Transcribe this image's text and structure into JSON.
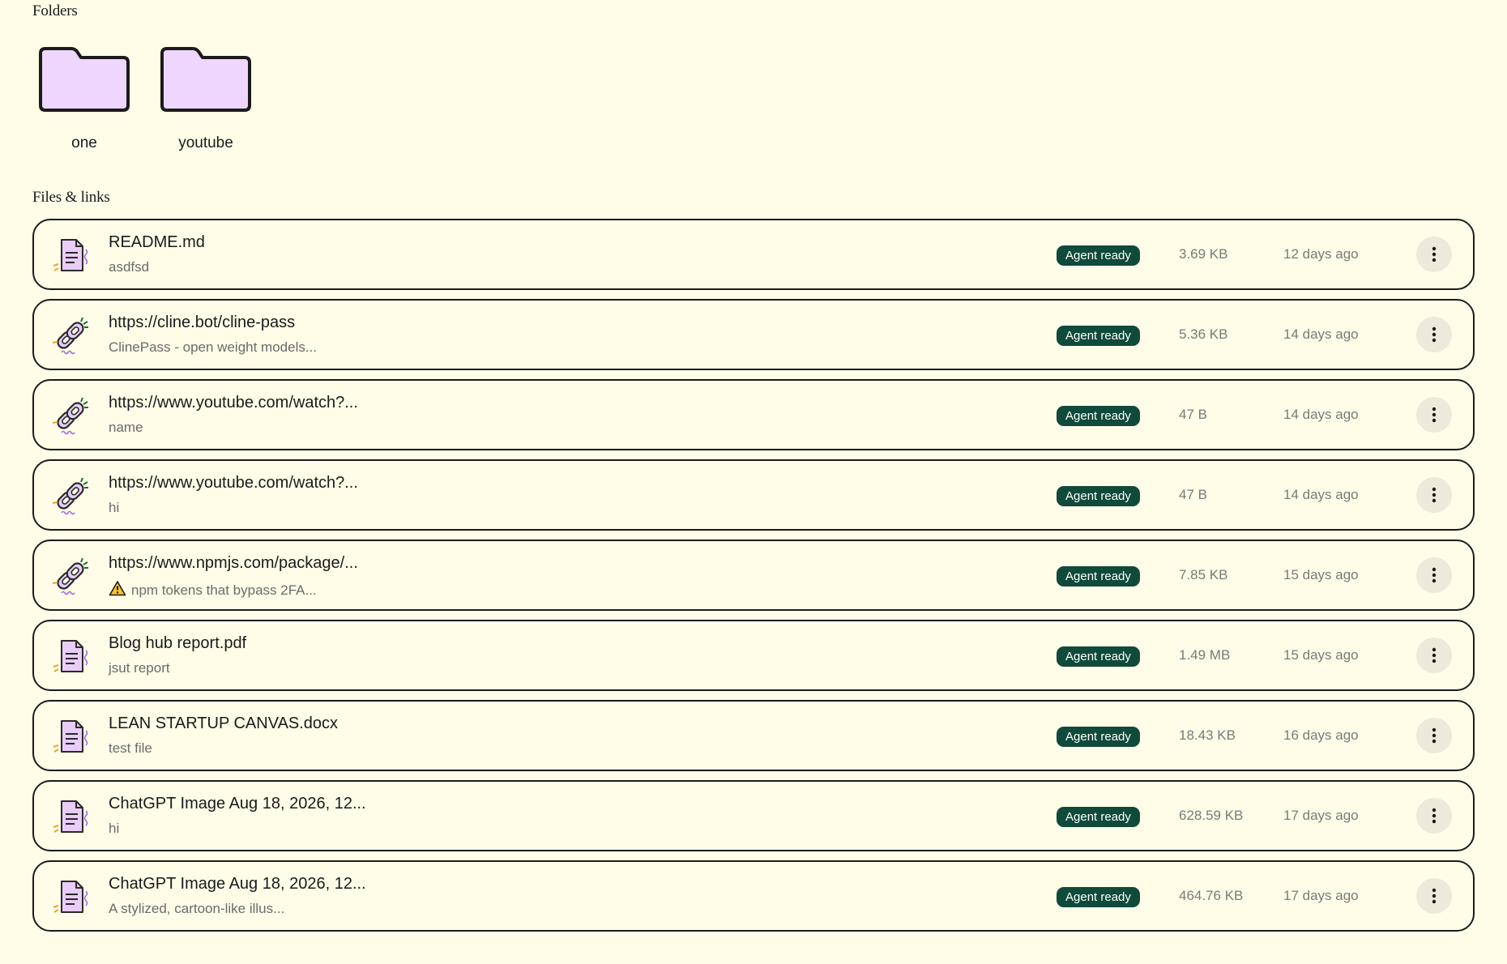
{
  "folders_section": {
    "title": "Folders",
    "items": [
      {
        "name": "one"
      },
      {
        "name": "youtube"
      }
    ]
  },
  "files_section": {
    "title": "Files & links",
    "items": [
      {
        "type": "file",
        "title": "README.md",
        "description": "asdfsd",
        "warning": false,
        "badge": "Agent ready",
        "size": "3.69 KB",
        "date": "12 days ago"
      },
      {
        "type": "link",
        "title": "https://cline.bot/cline-pass",
        "description": "ClinePass - open weight models...",
        "warning": false,
        "badge": "Agent ready",
        "size": "5.36 KB",
        "date": "14 days ago"
      },
      {
        "type": "link",
        "title": "https://www.youtube.com/watch?...",
        "description": "name",
        "warning": false,
        "badge": "Agent ready",
        "size": "47 B",
        "date": "14 days ago"
      },
      {
        "type": "link",
        "title": "https://www.youtube.com/watch?...",
        "description": "hi",
        "warning": false,
        "badge": "Agent ready",
        "size": "47 B",
        "date": "14 days ago"
      },
      {
        "type": "link",
        "title": "https://www.npmjs.com/package/...",
        "description": "npm tokens that bypass 2FA...",
        "warning": true,
        "badge": "Agent ready",
        "size": "7.85 KB",
        "date": "15 days ago"
      },
      {
        "type": "file",
        "title": "Blog hub report.pdf",
        "description": "jsut report",
        "warning": false,
        "badge": "Agent ready",
        "size": "1.49 MB",
        "date": "15 days ago"
      },
      {
        "type": "file",
        "title": "LEAN STARTUP CANVAS.docx",
        "description": "test file",
        "warning": false,
        "badge": "Agent ready",
        "size": "18.43 KB",
        "date": "16 days ago"
      },
      {
        "type": "file",
        "title": "ChatGPT Image Aug 18, 2026, 12...",
        "description": "hi",
        "warning": false,
        "badge": "Agent ready",
        "size": "628.59 KB",
        "date": "17 days ago"
      },
      {
        "type": "file",
        "title": "ChatGPT Image Aug 18, 2026, 12...",
        "description": "A stylized, cartoon-like illus...",
        "warning": false,
        "badge": "Agent ready",
        "size": "464.76 KB",
        "date": "17 days ago"
      }
    ]
  },
  "icons": {
    "folder": "folder-icon",
    "file": "document-icon",
    "link": "link-icon",
    "warning": "warning-icon",
    "menu": "more-vertical-icon"
  },
  "colors": {
    "background": "#fffde8",
    "folder_fill": "#efd6ff",
    "badge_bg": "#0f4a3a",
    "menu_bg": "#edeadb"
  }
}
